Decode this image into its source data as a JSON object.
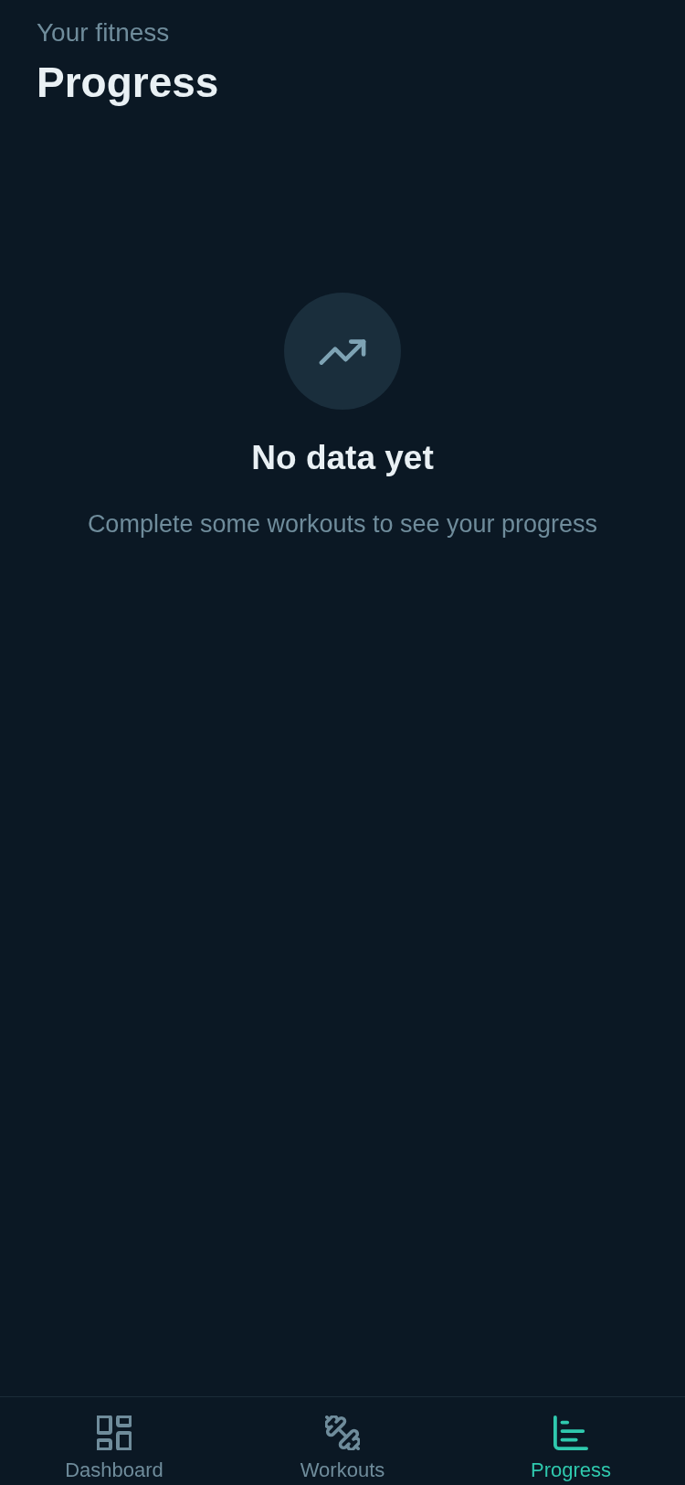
{
  "header": {
    "subtitle": "Your fitness",
    "title": "Progress"
  },
  "empty_state": {
    "title": "No data yet",
    "message": "Complete some workouts to see your progress"
  },
  "tab_bar": [
    {
      "kind": "dashboard",
      "label": "Dashboard",
      "selected": false
    },
    {
      "kind": "workouts",
      "label": "Workouts",
      "selected": false
    },
    {
      "kind": "progress",
      "label": "Progress",
      "selected": true
    }
  ]
}
